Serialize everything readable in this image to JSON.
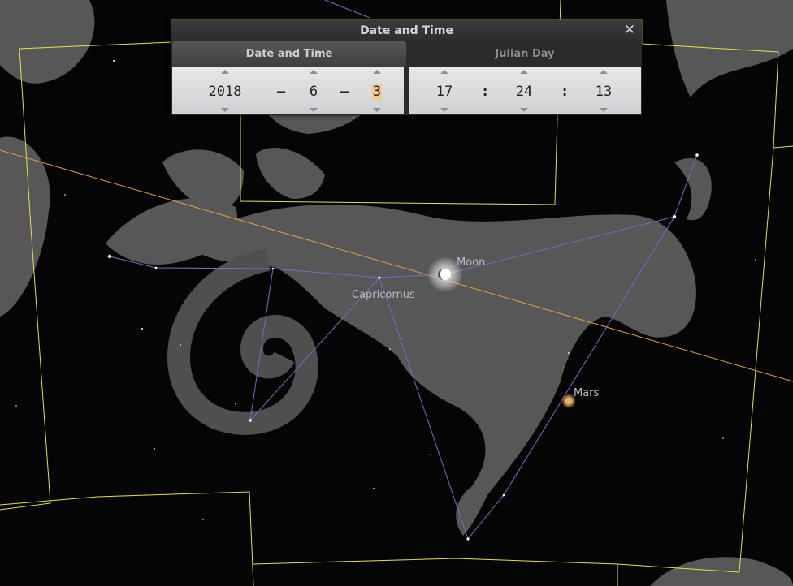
{
  "dialog": {
    "title": "Date and Time",
    "close_glyph": "✕",
    "tabs": {
      "date_time": "Date and Time",
      "julian_day": "Julian Day"
    },
    "date": {
      "year": "2018",
      "month": "6",
      "day": "3",
      "separator": "–"
    },
    "time": {
      "hour": "17",
      "minute": "24",
      "second": "13",
      "separator": ":"
    }
  },
  "sky": {
    "constellation_label": "Capricornus",
    "moon_label": "Moon",
    "mars_label": "Mars"
  },
  "colors": {
    "boundary": "#e6e04a",
    "ecliptic": "#e0a33c",
    "constellation_lines": "#7070c8",
    "mars": "#e8b36a"
  }
}
